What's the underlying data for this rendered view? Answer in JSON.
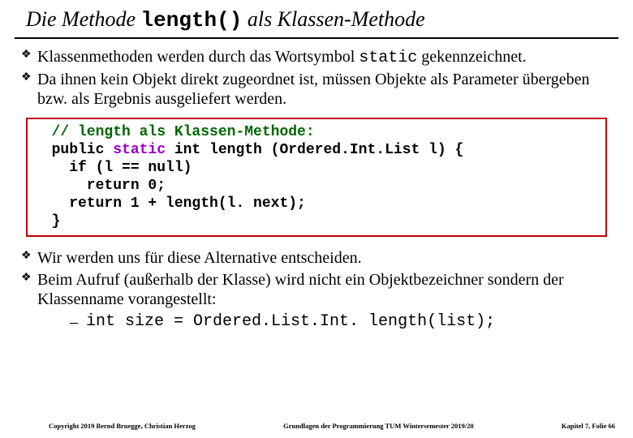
{
  "title": {
    "pre": "Die Methode ",
    "code": "length()",
    "post": " als Klassen-Methode"
  },
  "bullets_top": {
    "b1_pre": "Klassenmethoden werden durch das Wortsymbol ",
    "b1_code": "static",
    "b1_post": " gekennzeichnet.",
    "b2": "Da ihnen kein Objekt direkt zugeordnet ist, müssen Objekte als Parameter übergeben bzw. als Ergebnis ausgeliefert werden."
  },
  "code": {
    "l1": "  // length als Klassen-Methode:",
    "l2a": "  public ",
    "l2b": "static",
    "l2c": " int length (Ordered.Int.List l) {",
    "l3": "    if (l == null)",
    "l4": "      return 0;",
    "l5": "    return 1 + length(l. next);",
    "l6": "  }"
  },
  "bullets_bottom": {
    "b1": "Wir werden uns für diese Alternative entscheiden.",
    "b2": "Beim Aufruf (außerhalb der Klasse) wird nicht ein Objektbezeichner sondern der Klassenname vorangestellt:",
    "sub1": "int size = Ordered.List.Int. length(list);"
  },
  "footer": {
    "left": "Copyright 2019 Bernd Bruegge, Christian Herzog",
    "center": "Grundlagen der Programmierung  TUM Wintersemester 2019/20",
    "right": "Kapitel 7, Folie 66"
  }
}
